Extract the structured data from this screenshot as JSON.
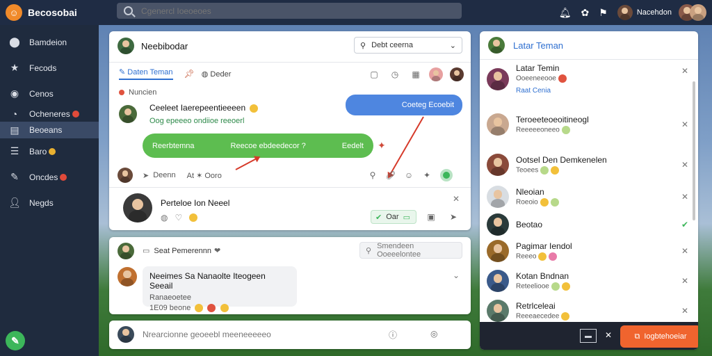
{
  "topbar": {
    "brand": "Becosobai",
    "search_placeholder": "Cgenercl Ioeoeoes",
    "user_name": "Nacehdon",
    "icons": [
      "bell-icon",
      "gift-icon",
      "flag-icon"
    ]
  },
  "sidebar": {
    "items": [
      {
        "label": "Bamdeion",
        "icon": "home-icon"
      },
      {
        "label": "Fecods",
        "icon": "star-icon"
      },
      {
        "label": "Cenos",
        "icon": "circle-icon"
      },
      {
        "label": "Ocheneres",
        "icon": "chat-icon",
        "badge": "red"
      },
      {
        "label": "Beoeans",
        "icon": "grid-icon",
        "active": true
      },
      {
        "label": "Baro",
        "icon": "list-icon",
        "badge": "gold"
      },
      {
        "label": "Oncdes",
        "icon": "pen-icon",
        "badge": "red"
      },
      {
        "label": "Negds",
        "icon": "person-icon"
      }
    ]
  },
  "chat": {
    "title": "Neebibodar",
    "dropdown": "Debt ceerna",
    "tabs": [
      {
        "label": "Daten Teman",
        "active": true
      },
      {
        "label": "Deder"
      }
    ],
    "section_label": "Nuncien",
    "message_title": "Ceeleet Iaerepeentieeeen",
    "message_sub": "Oog epeeeo ondiioe reeoerl",
    "blue_bubble": "Coeteg Ecoebit",
    "green_bubble_left": "Reerbtemna",
    "green_bubble_mid": "Reecoe ebdeedecor ?",
    "green_bubble_right": "Eedelt",
    "action_left": "Deenn",
    "action_mid": "At ✶ Ooro",
    "compose_title": "Perteloe Ion Neeel",
    "compose_chip": "Oar"
  },
  "feed": {
    "title": "Seat Pemerennn",
    "search_placeholder": "Smendeen Ooeeelontee",
    "post_title": "Neeimes Sa Nanaolte Iteogeen Seeail",
    "post_sub": "Ranaeoetee",
    "post_meta": "1E09 beone"
  },
  "composer": {
    "placeholder": "Nrearcionne geoeebl meeneeeeeo"
  },
  "friends": {
    "title": "Latar Teman",
    "list": [
      {
        "name": "Latar Temin",
        "sub": "Ooeeneeooe",
        "extra": "Raat Cenia",
        "close": true
      },
      {
        "name": "Teroeeteoeoitineogl",
        "sub": "Reeeeeoneeo",
        "close": true
      },
      {
        "name": "Ootsel Den Demkenelen",
        "sub": "Teoees",
        "close": true
      },
      {
        "name": "Nleoian",
        "sub": "Roeoio",
        "close": true
      },
      {
        "name": "Beotao",
        "sub": "",
        "check": true
      },
      {
        "name": "Pagimar Iendol",
        "sub": "Reeeo",
        "close": true
      },
      {
        "name": "Kotan Bndnan",
        "sub": "Reteeliooe",
        "close": true
      },
      {
        "name": "Retrlceleai",
        "sub": "Reeeaecedee",
        "close": true
      }
    ],
    "footer_button": "Iogbtehoeiar"
  },
  "colors": {
    "accent_blue": "#4e86e0",
    "accent_green": "#5dbd50",
    "accent_orange": "#f0642e",
    "sidebar_bg": "#1f2b3e"
  }
}
